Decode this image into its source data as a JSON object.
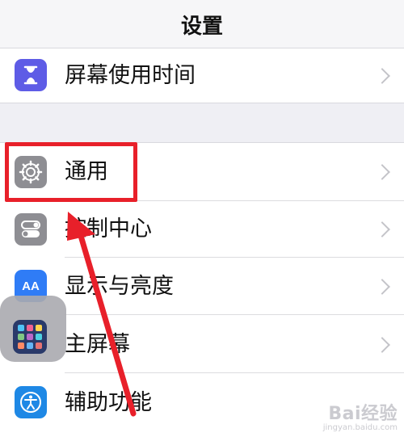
{
  "nav": {
    "title": "设置"
  },
  "rows": [
    {
      "label": "屏幕使用时间",
      "icon": "hourglass-icon",
      "icon_color": "#5e5ce6"
    },
    {
      "label": "通用",
      "icon": "gear-icon",
      "icon_color": "#8e8e93"
    },
    {
      "label": "控制中心",
      "icon": "toggle-icon",
      "icon_color": "#8e8e93"
    },
    {
      "label": "显示与亮度",
      "icon": "aa-icon",
      "icon_color": "#2f7cf6",
      "icon_text": "AA"
    },
    {
      "label": "主屏幕",
      "icon": "home-screen-icon",
      "icon_color": "#2f6ff0"
    },
    {
      "label": "辅助功能",
      "icon": "accessibility-icon",
      "icon_color": "#1e88e5"
    }
  ],
  "annotation": {
    "color": "#e8202a"
  },
  "watermark": {
    "logo": "Bai经验",
    "sub": "jingyan.baidu.com"
  }
}
